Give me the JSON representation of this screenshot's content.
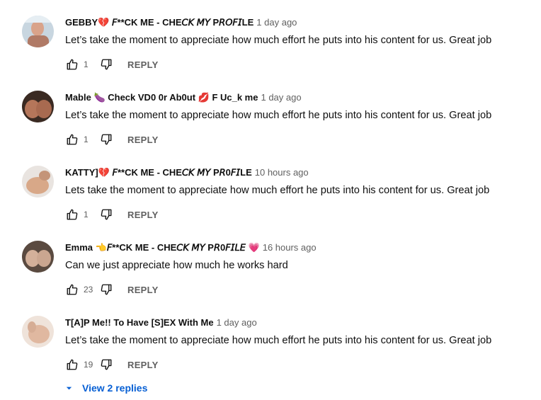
{
  "comments": [
    {
      "author": "GEBBY💔 𝘍**CK ME - CHE𝘊𝘒 𝘔𝘠 P𝘙𝘖𝘍𝘐LE",
      "time": "1 day ago",
      "text": "Let’s take the moment to appreciate how much effort he puts into his content for us. Great job",
      "likes": "1",
      "reply_label": "REPLY"
    },
    {
      "author": "Mable 🍆 Check VD0 0r Ab0ut 💋 F Uc_k me",
      "time": "1 day ago",
      "text": "Let’s take the moment to appreciate how much effort he puts into his content for us. Great job",
      "likes": "1",
      "reply_label": "REPLY"
    },
    {
      "author": "KATTY]💔 𝘍**CK ME - CHE𝘊𝘒 𝘔𝘠 P𝘙0𝘍𝘐LE",
      "time": "10 hours ago",
      "text": "Lets take the moment to appreciate how much effort he puts into his content for us. Great job",
      "likes": "1",
      "reply_label": "REPLY"
    },
    {
      "author": "Emma 👈𝘍**CK ME - CHE𝘊𝘒 𝘔𝘠 P𝘙0𝘍𝘐𝘓𝘌 💗",
      "time": "16 hours ago",
      "text": "Can we just appreciate how much he works hard",
      "likes": "23",
      "reply_label": "REPLY"
    },
    {
      "author": "T[A]P Me!! To Have [S]EX With Me",
      "time": "1 day ago",
      "text": "Let’s take the moment to appreciate how much effort he puts into his content for us. Great job",
      "likes": "19",
      "reply_label": "REPLY"
    }
  ],
  "view_replies": "View 2 replies",
  "colors": {
    "text": "#0f0f0f",
    "secondary": "#606060",
    "link": "#065fd4"
  },
  "icons": [
    "thumb-up-icon",
    "thumb-down-icon",
    "caret-down-icon"
  ]
}
